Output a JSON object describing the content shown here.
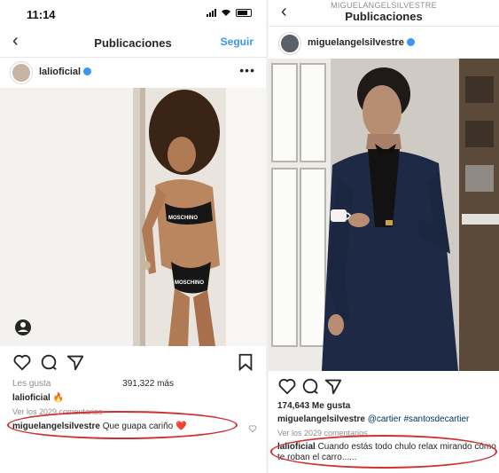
{
  "left_post": {
    "status_time": "11:14",
    "nav_title": "Publicaciones",
    "follow_label": "Seguir",
    "username": "lalioficial",
    "likes_prefix": "Les gusta",
    "likes_count": "391,322 más",
    "caption_user": "lalioficial",
    "caption_emoji": "🔥",
    "view_comments": "Ver los 2029 comentarios",
    "comment_user": "miguelangelsilvestre",
    "comment_text": "Que guapa cariño",
    "comment_emoji": "❤️",
    "photo_text_1": "MOSCHINO",
    "photo_text_2": "MOSCHINO"
  },
  "right_post": {
    "nav_subtitle": "MIGUELANGELSILVESTRE",
    "nav_title": "Publicaciones",
    "username": "miguelangelsilvestre",
    "likes": "174,643 Me gusta",
    "caption_user": "miguelangelsilvestre",
    "caption_mention": "@cartier",
    "caption_hashtag": "#santosdecartier",
    "view_comments": "Ver los 2029 comentarios",
    "comment_user": "lalioficial",
    "comment_line1": "Cuando estás todo chulo relax mirando cómo",
    "comment_line2": "te roban el carro......"
  },
  "colors": {
    "link_blue": "#3897f0",
    "highlight_ring": "#d23030",
    "heart": "#e0245e"
  }
}
